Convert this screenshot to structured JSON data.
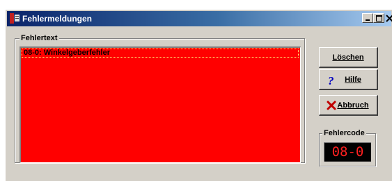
{
  "window": {
    "title": "Fehlermeldungen",
    "controls": {
      "minimize": "_",
      "maximize": "□",
      "close": "×"
    }
  },
  "error_group": {
    "label": "Fehlertext",
    "items": [
      "08-0: Winkelgeberfehler"
    ],
    "selected_index": 0,
    "list_color": "#ff0000"
  },
  "buttons": {
    "loeschen": "Löschen",
    "hilfe": "Hilfe",
    "abbruch": "Abbruch"
  },
  "icons": {
    "hilfe": "question-mark-icon",
    "abbruch": "red-x-icon"
  },
  "error_code": {
    "label": "Fehlercode",
    "value": "08-0",
    "display_color": "#ff2020"
  }
}
